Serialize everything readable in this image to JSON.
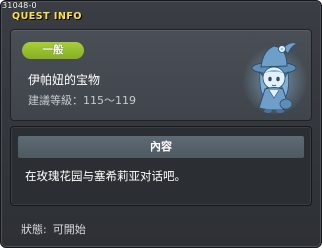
{
  "window": {
    "quest_id": "31048-0",
    "title": "QUEST INFO"
  },
  "quest": {
    "category": "一般",
    "name": "伊帕妞的宝物",
    "level_label": "建議等級",
    "level_value": "：115～119"
  },
  "content": {
    "header": "內容",
    "text": "在玫瑰花园与塞希莉亚对话吧。"
  },
  "status": {
    "label": "狀態:",
    "value": "可開始"
  },
  "npc": {
    "icon": "npc-portrait-icon"
  },
  "colors": {
    "title": "#ffe24a",
    "badge": "#9bc52f",
    "content_header": "#56636b"
  }
}
